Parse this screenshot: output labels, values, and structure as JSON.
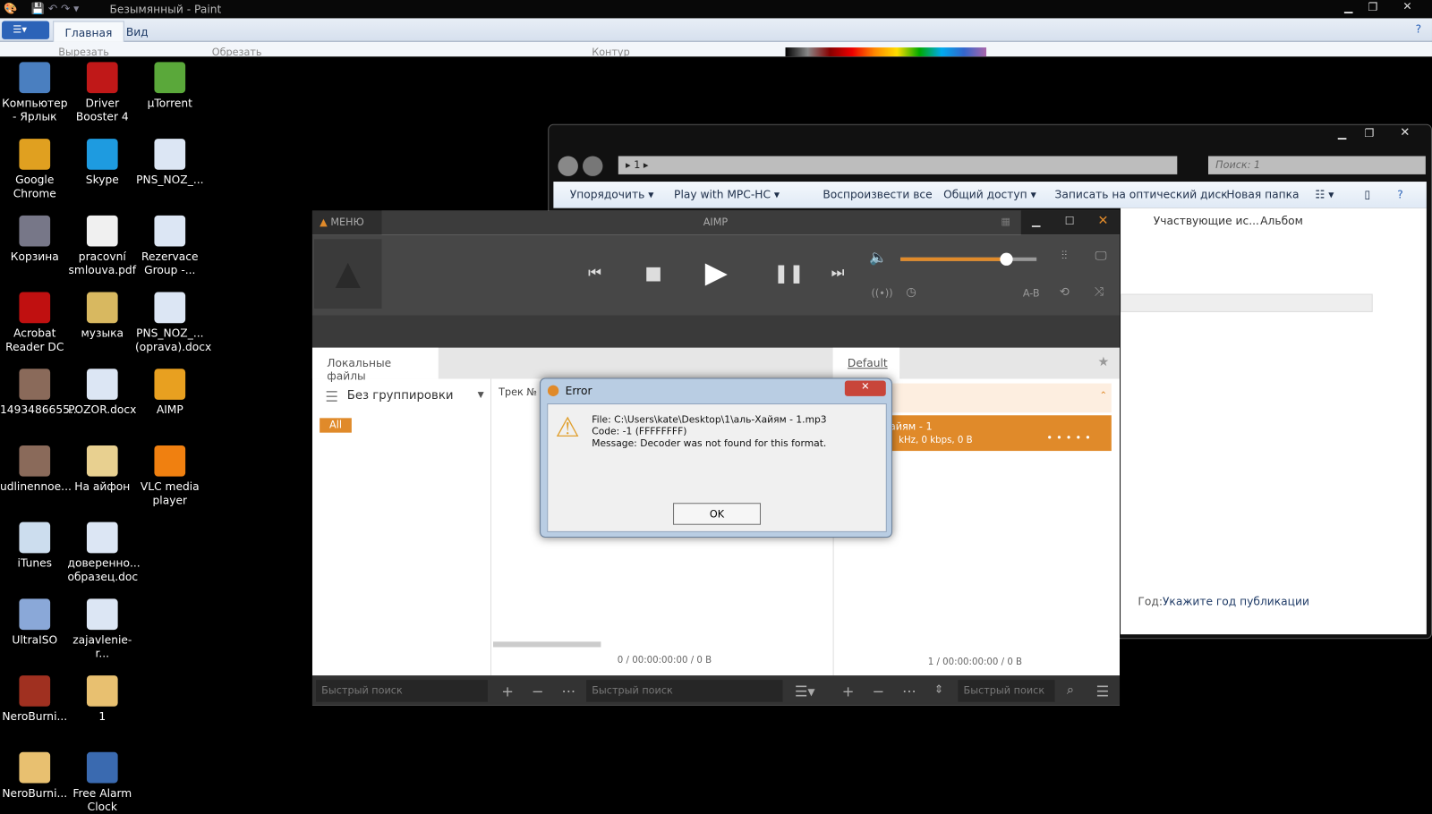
{
  "paint": {
    "title": "Безымянный - Paint",
    "tabs": [
      "Главная",
      "Вид"
    ],
    "ribbon": [
      "Вырезать",
      "Обрезать",
      "Контур"
    ]
  },
  "desktop": {
    "icons": [
      {
        "label": "Компьютер - Ярлык",
        "color": "#4a7fc0"
      },
      {
        "label": "Driver Booster 4",
        "color": "#c01818"
      },
      {
        "label": "µTorrent",
        "color": "#5aa83a"
      },
      {
        "label": "Google Chrome",
        "color": "#e0a020"
      },
      {
        "label": "Skype",
        "color": "#1e9be0"
      },
      {
        "label": "PNS_NOZ_...",
        "color": "#dce6f4"
      },
      {
        "label": "Корзина",
        "color": "#778"
      },
      {
        "label": "pracovní smlouva.pdf",
        "color": "#f0f0f0"
      },
      {
        "label": "Rezervace Group -...",
        "color": "#dce6f4"
      },
      {
        "label": "Acrobat Reader DC",
        "color": "#c01010"
      },
      {
        "label": "музыка",
        "color": "#d8b860"
      },
      {
        "label": "PNS_NOZ_... (oprava).docx",
        "color": "#dce6f4"
      },
      {
        "label": "1493486655...",
        "color": "#8a6a5a"
      },
      {
        "label": "POZOR.docx",
        "color": "#dce6f4"
      },
      {
        "label": "AIMP",
        "color": "#e8a020"
      },
      {
        "label": "udlinennoe...",
        "color": "#8a6a5a"
      },
      {
        "label": "На айфон",
        "color": "#e8d090"
      },
      {
        "label": "VLC media player",
        "color": "#f08010"
      },
      {
        "label": "iTunes",
        "color": "#cde"
      },
      {
        "label": "доверенно... образец.doc",
        "color": "#dce6f4"
      },
      {
        "label": "",
        "color": ""
      },
      {
        "label": "UltraISO",
        "color": "#8aa8d8"
      },
      {
        "label": "zajavlenie-r...",
        "color": "#dce6f4"
      },
      {
        "label": "",
        "color": ""
      },
      {
        "label": "NeroBurni...",
        "color": "#a03020"
      },
      {
        "label": "1",
        "color": "#e8c070"
      },
      {
        "label": "",
        "color": ""
      },
      {
        "label": "NeroBurni...",
        "color": "#e8c070"
      },
      {
        "label": "Free Alarm Clock",
        "color": "#3a6ab0"
      }
    ]
  },
  "explorer": {
    "path": "1",
    "search_placeholder": "Поиск: 1",
    "toolbar": [
      "Упорядочить ▾",
      "Play with MPC-HC ▾",
      "Воспроизвести все",
      "Общий доступ ▾",
      "Записать на оптический диск",
      "Новая папка"
    ],
    "columns": [
      "Участвующие ис...",
      "Альбом"
    ],
    "year_label": "Год:",
    "year_value": "Укажите год публикации"
  },
  "aimp": {
    "menu": "МЕНЮ",
    "title": "AIMP",
    "volume": 0.78,
    "ab": "A-B",
    "tab_local": "Локальные файлы",
    "tab_default": "Default",
    "grouping": "Без группировки",
    "all": "All",
    "track_col": "Трек №",
    "track_title": "айям - 1",
    "track_info": "kHz, 0 kbps, 0 B",
    "status_left": "0 / 00:00:00:00 / 0 B",
    "status_right": "1 / 00:00:00:00 / 0 B",
    "search_placeholder": "Быстрый поиск",
    "accent": "#e08a2a"
  },
  "dialog": {
    "title": "Error",
    "line1": "File: C:\\Users\\kate\\Desktop\\1\\аль-Хайям - 1.mp3",
    "line2": "Code: -1 (FFFFFFFF)",
    "line3": "Message: Decoder was not found for this format.",
    "ok": "OK"
  }
}
